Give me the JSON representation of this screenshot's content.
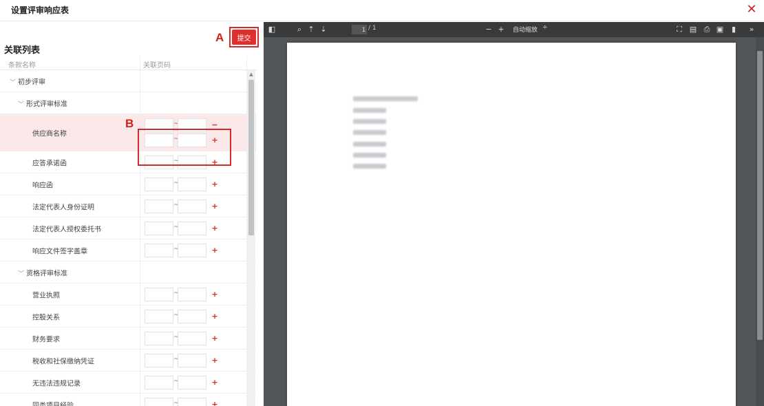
{
  "dialog": {
    "title": "设置评审响应表",
    "close_icon": "close-icon"
  },
  "left_panel": {
    "list_title": "关联列表",
    "submit_label": "提交",
    "annotation_a": "A",
    "annotation_b": "B",
    "columns": [
      "条款名称",
      "关联页码"
    ],
    "rows": [
      {
        "label": "初步评审",
        "level": 1,
        "group": true
      },
      {
        "label": "形式评审标准",
        "level": 2,
        "group": true
      },
      {
        "label": "供应商名称",
        "level": 3,
        "ranges": 2
      },
      {
        "label": "应答承诺函",
        "level": 3,
        "ranges": 1
      },
      {
        "label": "响应函",
        "level": 3,
        "ranges": 1
      },
      {
        "label": "法定代表人身份证明",
        "level": 3,
        "ranges": 1
      },
      {
        "label": "法定代表人授权委托书",
        "level": 3,
        "ranges": 1
      },
      {
        "label": "响应文件签字盖章",
        "level": 3,
        "ranges": 1
      },
      {
        "label": "资格评审标准",
        "level": 2,
        "group": true
      },
      {
        "label": "营业执照",
        "level": 3,
        "ranges": 1
      },
      {
        "label": "控股关系",
        "level": 3,
        "ranges": 1
      },
      {
        "label": "财务要求",
        "level": 3,
        "ranges": 1
      },
      {
        "label": "税收和社保缴纳凭证",
        "level": 3,
        "ranges": 1
      },
      {
        "label": "无违法违规记录",
        "level": 3,
        "ranges": 1
      },
      {
        "label": "同类项目经验",
        "level": 3,
        "ranges": 1
      }
    ],
    "tilde": "~",
    "minus": "−",
    "plus": "+"
  },
  "pdf_viewer": {
    "page_current": "1",
    "page_total": "/ 1",
    "zoom_label": "自动缩放",
    "zoom_arrow": "÷",
    "toolbar_icons": [
      "sidebar-toggle-icon",
      "search-icon",
      "prev-page-icon",
      "next-page-icon",
      "zoom-out-icon",
      "zoom-in-icon",
      "fullscreen-icon",
      "open-file-icon",
      "print-icon",
      "download-icon",
      "bookmark-icon",
      "tools-icon"
    ]
  },
  "colors": {
    "accent": "#e0302d",
    "highlight_row": "#fbe9e9",
    "viewer_bg": "#525659",
    "toolbar_bg": "#3a3a3a"
  }
}
